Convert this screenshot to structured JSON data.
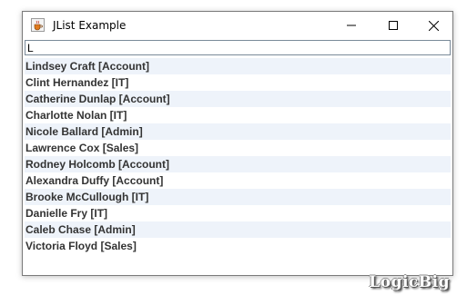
{
  "window": {
    "title": "JList Example",
    "app_icon": "java-cup-icon",
    "controls": [
      "minimize-icon",
      "maximize-icon",
      "close-icon"
    ]
  },
  "filter": {
    "value": "L",
    "placeholder": ""
  },
  "list": {
    "items": [
      "Lindsey Craft [Account]",
      "Clint Hernandez [IT]",
      "Catherine Dunlap [Account]",
      "Charlotte Nolan [IT]",
      "Nicole Ballard [Admin]",
      "Lawrence Cox [Sales]",
      "Rodney Holcomb [Account]",
      "Alexandra Duffy [Account]",
      "Brooke McCullough [IT]",
      "Danielle Fry [IT]",
      "Caleb Chase [Admin]",
      "Victoria Floyd [Sales]"
    ]
  },
  "watermark": "LogicBig",
  "colors": {
    "row_alt": "#eef3fa",
    "text": "#333333",
    "border": "#7a7a7a"
  }
}
